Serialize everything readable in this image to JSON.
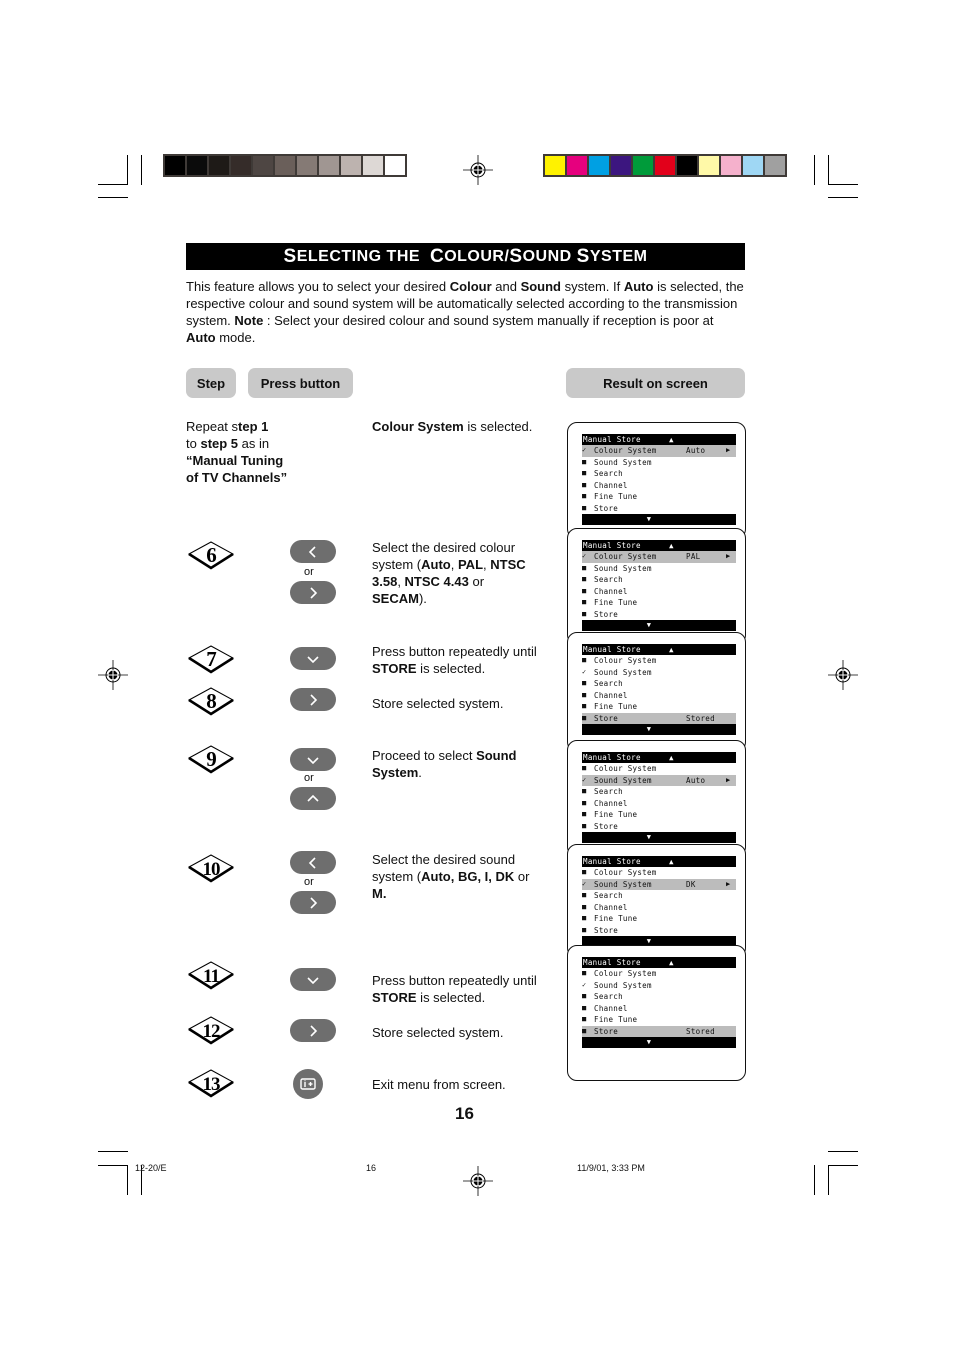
{
  "calibration": {
    "grey_swatches": [
      "#000000",
      "#0b0b0b",
      "#1e1a17",
      "#352c29",
      "#4e4643",
      "#6a5f5a",
      "#857a75",
      "#a09692",
      "#bdb3af",
      "#ddd8d5",
      "#ffffff"
    ],
    "color_swatches": [
      "#fff200",
      "#e6007e",
      "#00a0e3",
      "#3c167f",
      "#009b3a",
      "#e2001a",
      "#000000",
      "#fff9a8",
      "#f5b1cc",
      "#9fd7f4",
      "#a0a0a0"
    ]
  },
  "title": {
    "S": "S",
    "part1": "ELECTING THE",
    "C": "C",
    "part2": "OLOUR/",
    "S2": "S",
    "part3": "OUND",
    "S3": "S",
    "part4": "YSTEM"
  },
  "intro": {
    "t1": "This feature allows you to select your desired ",
    "b1": "Colour",
    "t2": " and ",
    "b2": "Sound",
    "t3": " system. If ",
    "b3": "Auto",
    "t4": " is selected, the respective colour and sound system will be automatically selected according to the transmission system. ",
    "b4": "Note",
    "t5": " : Select your desired colour and sound system manually if reception is poor at ",
    "b5": "Auto",
    "t6": " mode."
  },
  "headers": {
    "step": "Step",
    "press_button": "Press button",
    "result": "Result on screen"
  },
  "steps": {
    "repeat": {
      "t1": "Repeat s",
      "b1": "tep 1",
      "t2": "to ",
      "b2": "step 5",
      "t3": " as in",
      "b3": "“Manual Tuning",
      "b4": "of TV Channels”"
    },
    "colour_selected": {
      "b1": "Colour System",
      "t1": " is selected."
    },
    "s6": {
      "num": "6",
      "t1": "Select the desired colour system  (",
      "b1": "Auto",
      "t2": ", ",
      "b2": "PAL",
      "t3": ", ",
      "b3": "NTSC 3.58",
      "t4": ", ",
      "b4": "NTSC 4.43",
      "t5": " or ",
      "b5": "SECAM",
      "t6": ")."
    },
    "s7": {
      "num": "7",
      "t1": "Press button repeatedly until ",
      "b1": "STORE",
      "t2": " is selected."
    },
    "s8": {
      "num": "8",
      "t1": "Store selected system."
    },
    "s9": {
      "num": "9",
      "t1": "Proceed to select ",
      "b1": "Sound System",
      "t2": "."
    },
    "s10": {
      "num": "10",
      "t1": "Select the desired sound system  (",
      "b1": "Auto, BG, I,",
      "t2": " ",
      "b2": "DK",
      "t3": " or ",
      "b3": "M."
    },
    "s11": {
      "num": "11",
      "t1": "Press button repeatedly until ",
      "b1": "STORE",
      "t2": " is selected."
    },
    "s12": {
      "num": "12",
      "t1": "Store selected system."
    },
    "s13": {
      "num": "13",
      "t1": "Exit menu from screen."
    }
  },
  "buttons": {
    "or": "or",
    "left_icon": "chevron-left",
    "right_icon": "chevron-right",
    "down_icon": "chevron-down",
    "up_icon": "chevron-up",
    "menu_icon": "menu-info"
  },
  "screens": [
    {
      "title": "Manual Store",
      "up": "▲",
      "down": "▼",
      "items": [
        {
          "label": "Colour System",
          "mark": "check",
          "value": "Auto",
          "arrow": "▶",
          "hl": true
        },
        {
          "label": "Sound System",
          "mark": "bullet"
        },
        {
          "label": "Search",
          "mark": "bullet"
        },
        {
          "label": "Channel",
          "mark": "bullet"
        },
        {
          "label": "Fine Tune",
          "mark": "bullet"
        },
        {
          "label": "Store",
          "mark": "bullet"
        }
      ]
    },
    {
      "title": "Manual Store",
      "up": "▲",
      "down": "▼",
      "items": [
        {
          "label": "Colour System",
          "mark": "check",
          "value": "PAL",
          "arrow": "▶",
          "hl": true
        },
        {
          "label": "Sound System",
          "mark": "bullet"
        },
        {
          "label": "Search",
          "mark": "bullet"
        },
        {
          "label": "Channel",
          "mark": "bullet"
        },
        {
          "label": "Fine Tune",
          "mark": "bullet"
        },
        {
          "label": "Store",
          "mark": "bullet"
        }
      ]
    },
    {
      "title": "Manual Store",
      "up": "▲",
      "down": "▼",
      "items": [
        {
          "label": "Colour System",
          "mark": "bullet"
        },
        {
          "label": "Sound System",
          "mark": "check"
        },
        {
          "label": "Search",
          "mark": "bullet"
        },
        {
          "label": "Channel",
          "mark": "bullet"
        },
        {
          "label": "Fine Tune",
          "mark": "bullet"
        },
        {
          "label": "Store",
          "mark": "bullet",
          "value": "Stored",
          "hl": true
        }
      ]
    },
    {
      "title": "Manual Store",
      "up": "▲",
      "down": "▼",
      "items": [
        {
          "label": "Colour System",
          "mark": "bullet"
        },
        {
          "label": "Sound System",
          "mark": "check",
          "value": "Auto",
          "arrow": "▶",
          "hl": true
        },
        {
          "label": "Search",
          "mark": "bullet"
        },
        {
          "label": "Channel",
          "mark": "bullet"
        },
        {
          "label": "Fine Tune",
          "mark": "bullet"
        },
        {
          "label": "Store",
          "mark": "bullet"
        }
      ]
    },
    {
      "title": "Manual Store",
      "up": "▲",
      "down": "▼",
      "items": [
        {
          "label": "Colour System",
          "mark": "bullet"
        },
        {
          "label": "Sound System",
          "mark": "check",
          "value": "DK",
          "arrow": "▶",
          "hl": true
        },
        {
          "label": "Search",
          "mark": "bullet"
        },
        {
          "label": "Channel",
          "mark": "bullet"
        },
        {
          "label": "Fine Tune",
          "mark": "bullet"
        },
        {
          "label": "Store",
          "mark": "bullet"
        }
      ]
    },
    {
      "title": "Manual Store",
      "up": "▲",
      "down": "▼",
      "items": [
        {
          "label": "Colour System",
          "mark": "bullet"
        },
        {
          "label": "Sound System",
          "mark": "check"
        },
        {
          "label": "Search",
          "mark": "bullet"
        },
        {
          "label": "Channel",
          "mark": "bullet"
        },
        {
          "label": "Fine Tune",
          "mark": "bullet"
        },
        {
          "label": "Store",
          "mark": "bullet",
          "value": "Stored",
          "hl": true
        }
      ]
    }
  ],
  "page_number": "16",
  "slug": {
    "left": "12-20/E",
    "center": "16",
    "right": "11/9/01, 3:33 PM"
  }
}
